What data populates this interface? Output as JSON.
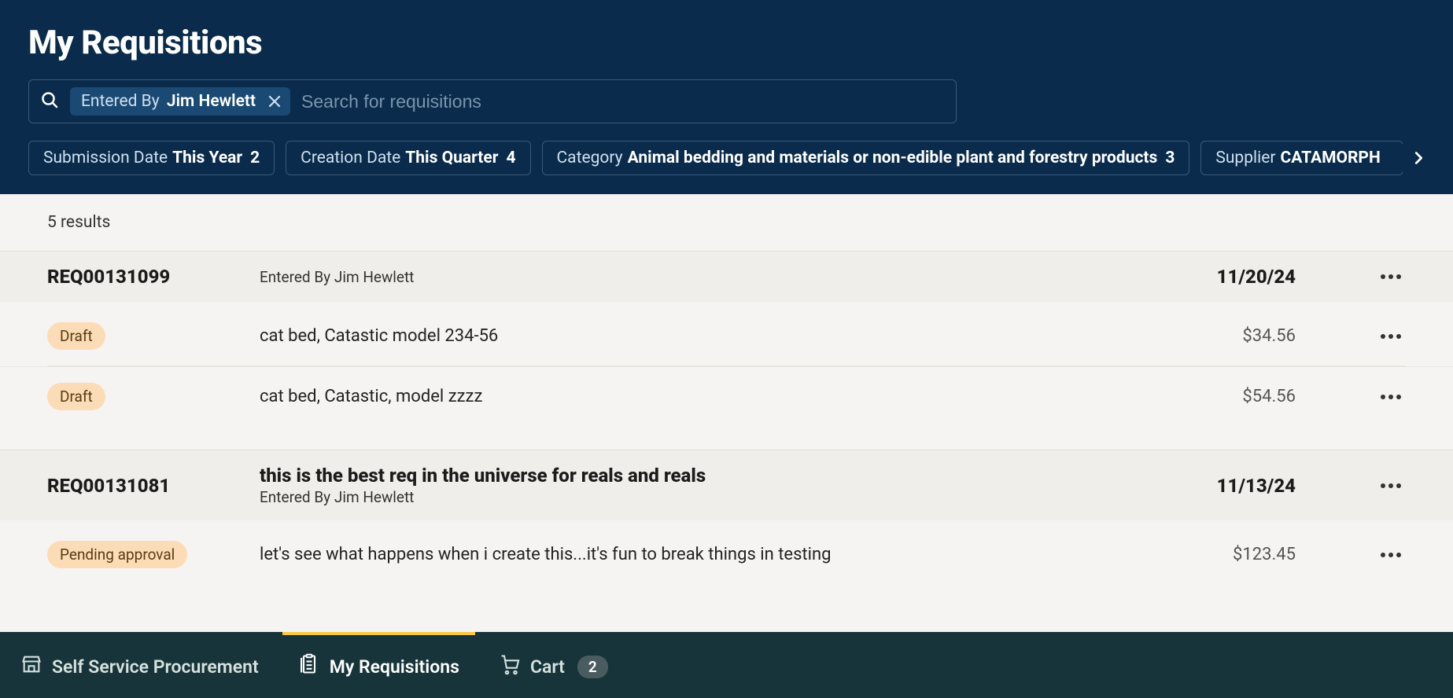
{
  "page_title": "My Requisitions",
  "search": {
    "placeholder": "Search for requisitions",
    "active_filter": {
      "label": "Entered By",
      "value": "Jim Hewlett"
    }
  },
  "facets": [
    {
      "label": "Submission Date",
      "value": "This Year",
      "count": "2"
    },
    {
      "label": "Creation Date",
      "value": "This Quarter",
      "count": "4"
    },
    {
      "label": "Category",
      "value": "Animal bedding and materials or non-edible plant and forestry products",
      "count": "3"
    },
    {
      "label": "Supplier",
      "value": "CATAMORPH",
      "count": ""
    }
  ],
  "results_count": "5 results",
  "requisitions": [
    {
      "id": "REQ00131099",
      "title": "",
      "entered_by": "Entered By Jim Hewlett",
      "date": "11/20/24",
      "lines": [
        {
          "status": "Draft",
          "description": "cat bed, Catastic model 234-56",
          "amount": "$34.56"
        },
        {
          "status": "Draft",
          "description": "cat bed, Catastic, model zzzz",
          "amount": "$54.56"
        }
      ]
    },
    {
      "id": "REQ00131081",
      "title": "this is the best req in the universe for reals and reals",
      "entered_by": "Entered By Jim Hewlett",
      "date": "11/13/24",
      "lines": [
        {
          "status": "Pending approval",
          "description": "let's see what happens when i create this...it's fun to break things in testing",
          "amount": "$123.45"
        }
      ]
    }
  ],
  "bottom_nav": {
    "items": [
      {
        "label": "Self Service Procurement",
        "icon": "storefront-icon"
      },
      {
        "label": "My Requisitions",
        "icon": "clipboard-icon",
        "active": true
      },
      {
        "label": "Cart",
        "icon": "cart-icon",
        "badge": "2"
      }
    ]
  }
}
